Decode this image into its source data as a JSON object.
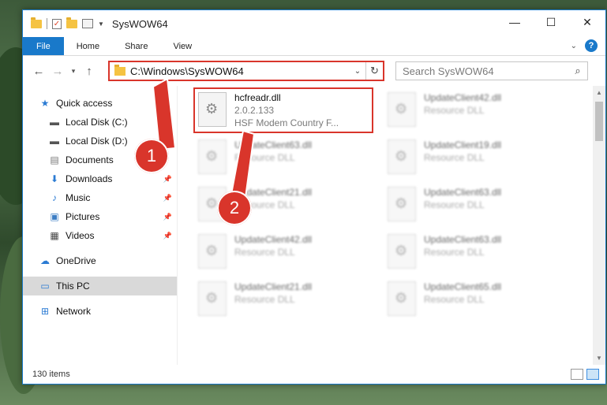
{
  "window": {
    "title": "SysWOW64",
    "minimize": "—",
    "maximize": "☐",
    "close": "✕"
  },
  "ribbon": {
    "tabs": [
      "File",
      "Home",
      "Share",
      "View"
    ]
  },
  "nav": {
    "address": "C:\\Windows\\SysWOW64",
    "search_placeholder": "Search SysWOW64"
  },
  "sidebar": {
    "items": [
      {
        "label": "Quick access",
        "icon": "star-icon"
      },
      {
        "label": "Local Disk (C:)",
        "icon": "drive-icon"
      },
      {
        "label": "Local Disk (D:)",
        "icon": "drive-icon"
      },
      {
        "label": "Documents",
        "icon": "documents-icon"
      },
      {
        "label": "Downloads",
        "icon": "download-icon"
      },
      {
        "label": "Music",
        "icon": "music-icon"
      },
      {
        "label": "Pictures",
        "icon": "pictures-icon"
      },
      {
        "label": "Videos",
        "icon": "videos-icon"
      },
      {
        "label": "OneDrive",
        "icon": "cloud-icon"
      },
      {
        "label": "This PC",
        "icon": "computer-icon"
      },
      {
        "label": "Network",
        "icon": "network-icon"
      }
    ]
  },
  "files": [
    {
      "name": "hcfreadr.dll",
      "line2": "2.0.2.133",
      "line3": "HSF Modem Country F..."
    },
    {
      "name": "UpdateClient42.dll",
      "line2": "Resource DLL"
    },
    {
      "name": "UpdateClient63.dll",
      "line2": "Resource DLL"
    },
    {
      "name": "UpdateClient19.dll",
      "line2": "Resource DLL"
    },
    {
      "name": "UpdateClient21.dll",
      "line2": "Resource DLL"
    },
    {
      "name": "UpdateClient63.dll",
      "line2": "Resource DLL"
    },
    {
      "name": "UpdateClient42.dll",
      "line2": "Resource DLL"
    },
    {
      "name": "UpdateClient63.dll",
      "line2": "Resource DLL"
    },
    {
      "name": "UpdateClient21.dll",
      "line2": "Resource DLL"
    },
    {
      "name": "UpdateClient65.dll",
      "line2": "Resource DLL"
    }
  ],
  "status": {
    "count": "130 items"
  },
  "callouts": [
    "1",
    "2"
  ],
  "colors": {
    "accent": "#1979ca",
    "highlight": "#d9352b"
  }
}
